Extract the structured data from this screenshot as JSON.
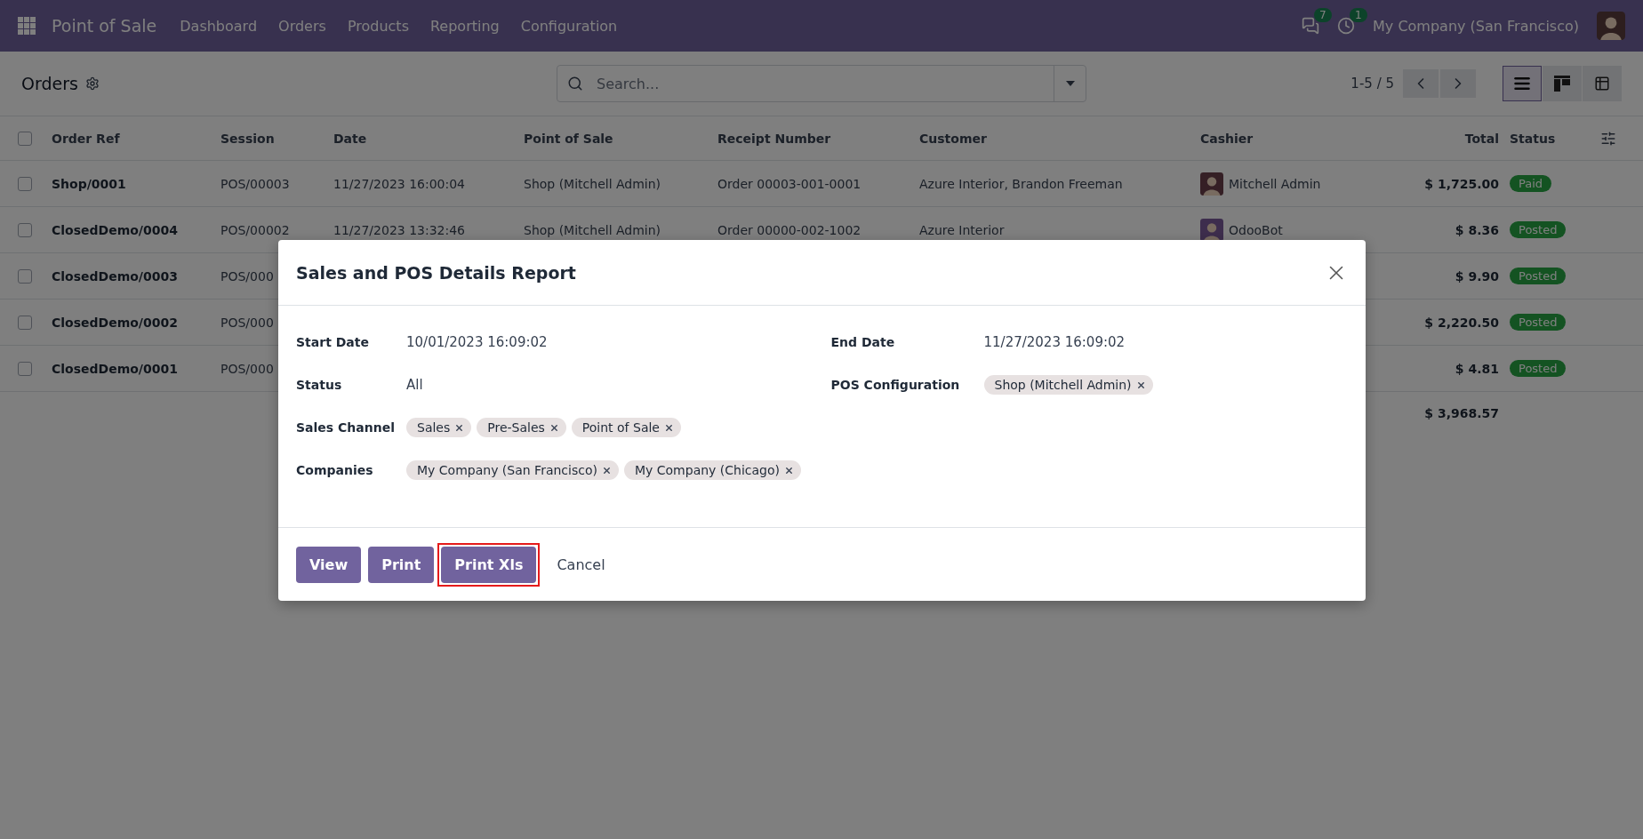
{
  "navbar": {
    "app_title": "Point of Sale",
    "menu": [
      "Dashboard",
      "Orders",
      "Products",
      "Reporting",
      "Configuration"
    ],
    "messages_badge": "7",
    "activities_badge": "1",
    "company": "My Company (San Francisco)"
  },
  "control_panel": {
    "title": "Orders",
    "search": {
      "placeholder": "Search..."
    },
    "pager": "1-5 / 5",
    "views": [
      {
        "kind": "list",
        "selected": true
      },
      {
        "kind": "kanban",
        "selected": false
      },
      {
        "kind": "pivot",
        "selected": false
      }
    ]
  },
  "table": {
    "select_all_checked": false,
    "columns": [
      "Order Ref",
      "Session",
      "Date",
      "Point of Sale",
      "Receipt Number",
      "Customer",
      "Cashier",
      "Total",
      "Status"
    ],
    "rows": [
      {
        "checked": false,
        "order_ref": "Shop/0001",
        "session": "POS/00003",
        "date": "11/27/2023 16:00:04",
        "point_of_sale": "Shop (Mitchell Admin)",
        "receipt_number": "Order 00003-001-0001",
        "customer": "Azure Interior, Brandon Freeman",
        "cashier": "Mitchell Admin",
        "total": "$ 1,725.00",
        "status": "Paid"
      },
      {
        "checked": false,
        "order_ref": "ClosedDemo/0004",
        "session": "POS/00002",
        "date": "11/27/2023 13:32:46",
        "point_of_sale": "Shop (Mitchell Admin)",
        "receipt_number": "Order 00000-002-1002",
        "customer": "Azure Interior",
        "cashier": "OdooBot",
        "total": "$ 8.36",
        "status": "Posted"
      },
      {
        "checked": false,
        "order_ref": "ClosedDemo/0003",
        "session": "POS/000",
        "total": "$ 9.90",
        "status": "Posted"
      },
      {
        "checked": false,
        "order_ref": "ClosedDemo/0002",
        "session": "POS/000",
        "total": "$ 2,220.50",
        "status": "Posted"
      },
      {
        "checked": false,
        "order_ref": "ClosedDemo/0001",
        "session": "POS/000",
        "total": "$ 4.81",
        "status": "Posted"
      }
    ],
    "sum_total": "$ 3,968.57"
  },
  "dialog": {
    "title": "Sales and POS Details Report",
    "left_fields": [
      {
        "label": "Start Date",
        "kind": "text",
        "value": "10/01/2023 16:09:02"
      },
      {
        "label": "Status",
        "kind": "text",
        "value": "All"
      },
      {
        "label": "Sales Channel",
        "kind": "tags",
        "tags": [
          "Sales",
          "Pre-Sales",
          "Point of Sale"
        ]
      },
      {
        "label": "Companies",
        "kind": "tags",
        "tags": [
          "My Company (San Francisco)",
          "My Company (Chicago)"
        ]
      }
    ],
    "right_fields": [
      {
        "label": "End Date",
        "kind": "text",
        "value": "11/27/2023 16:09:02"
      },
      {
        "label": "POS Configuration",
        "kind": "tags",
        "tags": [
          "Shop (Mitchell Admin)"
        ]
      }
    ],
    "buttons": [
      {
        "label": "View",
        "kind": "primary",
        "highlighted": false
      },
      {
        "label": "Print",
        "kind": "primary",
        "highlighted": false
      },
      {
        "label": "Print Xls",
        "kind": "primary",
        "highlighted": true
      },
      {
        "label": "Cancel",
        "kind": "secondary",
        "highlighted": false
      }
    ]
  }
}
